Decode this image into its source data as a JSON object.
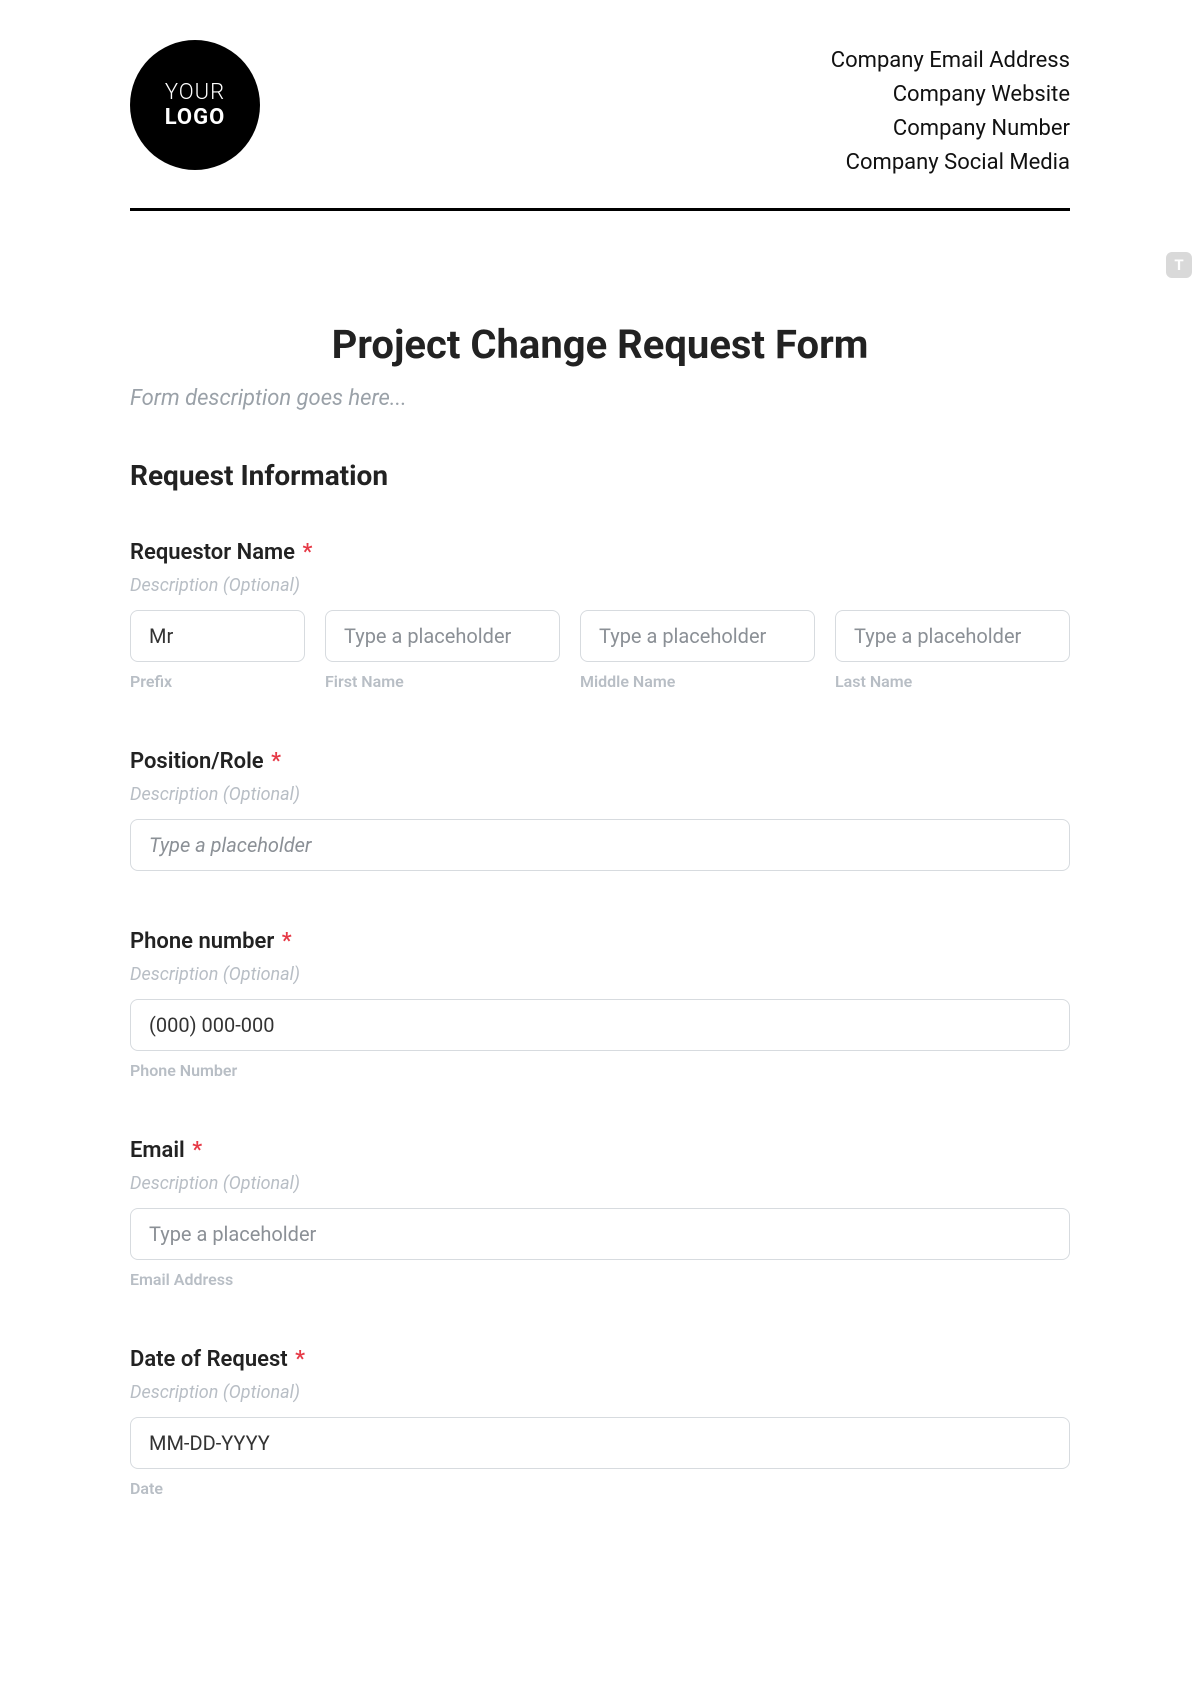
{
  "header": {
    "logo": {
      "line1": "YOUR",
      "line2": "LOGO"
    },
    "company": {
      "email": "Company Email Address",
      "website": "Company Website",
      "number": "Company Number",
      "social": "Company Social Media"
    }
  },
  "side_badge": "T",
  "form": {
    "title": "Project Change Request Form",
    "description_placeholder": "Form description goes here...",
    "section_title": "Request Information",
    "hint_text": "Description (Optional)",
    "required_mark": "*",
    "fields": {
      "requestor_name": {
        "label": "Requestor Name",
        "prefix": {
          "value": "Mr",
          "sublabel": "Prefix"
        },
        "first": {
          "placeholder": "Type a placeholder",
          "sublabel": "First Name"
        },
        "middle": {
          "placeholder": "Type a placeholder",
          "sublabel": "Middle Name"
        },
        "last": {
          "placeholder": "Type a placeholder",
          "sublabel": "Last Name"
        }
      },
      "position": {
        "label": "Position/Role",
        "placeholder": "Type a placeholder"
      },
      "phone": {
        "label": "Phone number",
        "value": "(000) 000-000",
        "sublabel": "Phone Number"
      },
      "email": {
        "label": "Email",
        "placeholder": "Type a placeholder",
        "sublabel": "Email Address"
      },
      "date": {
        "label": "Date of Request",
        "value": "MM-DD-YYYY",
        "sublabel": "Date"
      }
    }
  }
}
